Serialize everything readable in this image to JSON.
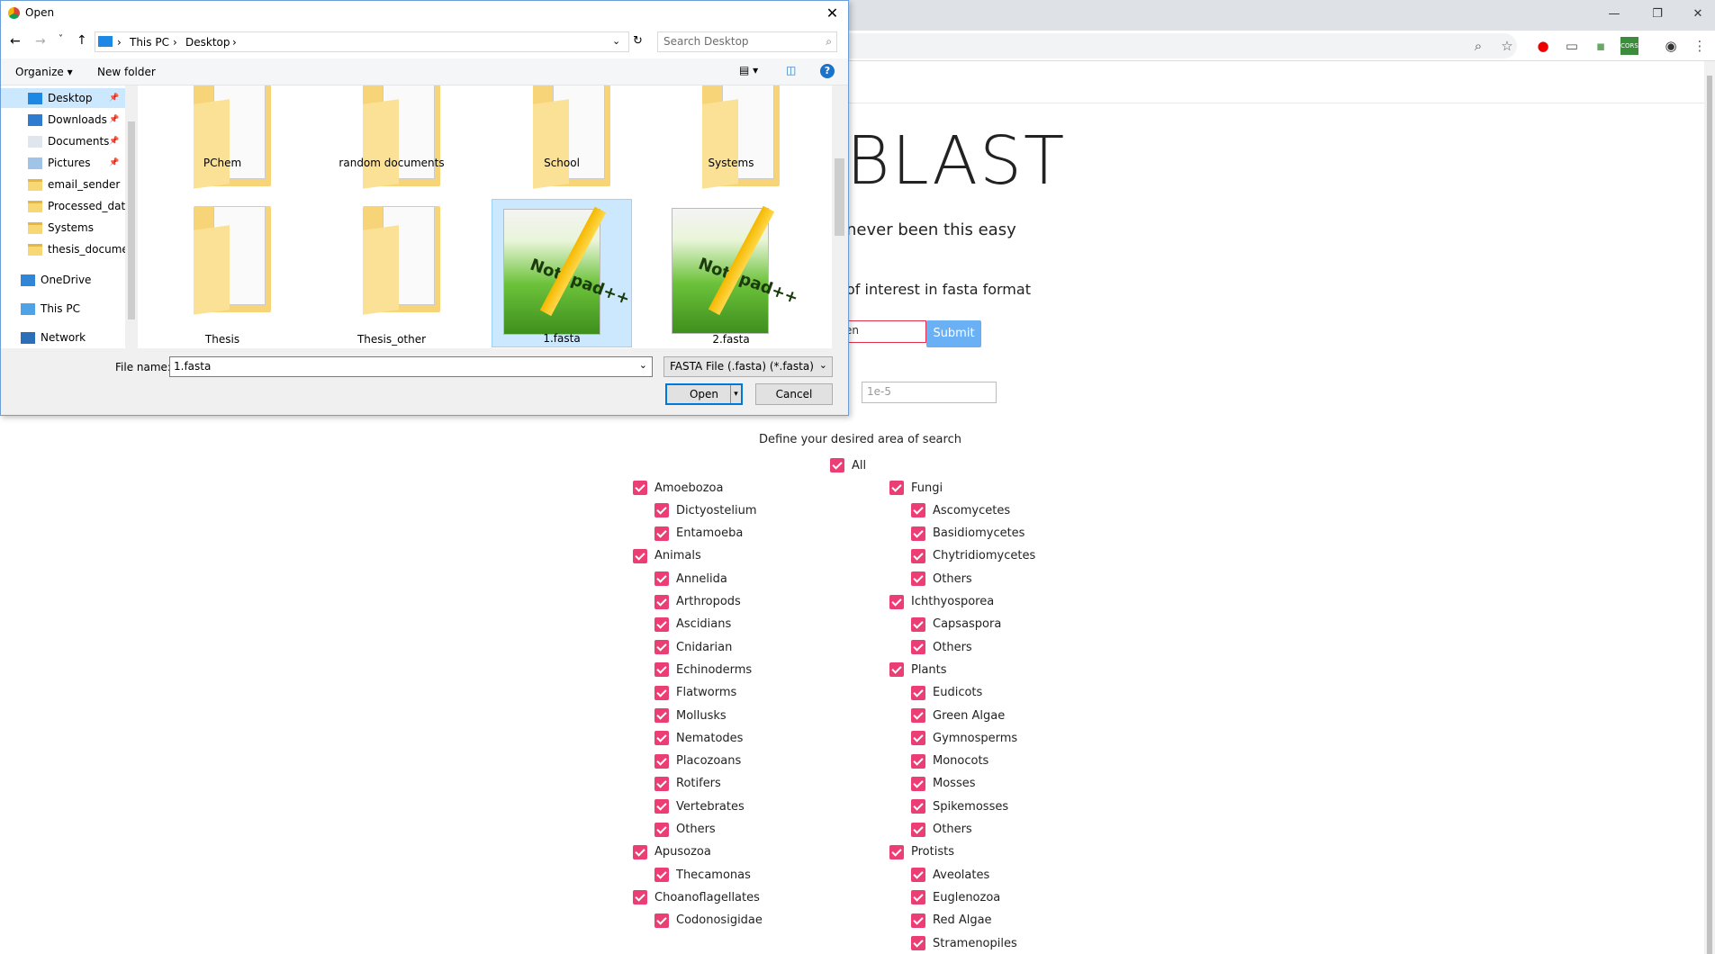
{
  "browser": {
    "window_controls": [
      "—",
      "❐",
      "✕"
    ],
    "extension_label": "CORS"
  },
  "page": {
    "title": "BLAST",
    "tagline": "never been this easy",
    "fasta_label": "of interest in fasta format",
    "sequence_input_value": "en",
    "submit_label": "Submit",
    "evalue_suffix": ")",
    "evalue_placeholder": "1e-5",
    "area_title": "Define your desired area of search",
    "all_label": "All",
    "left_column": [
      {
        "label": "Amoebozoa",
        "level": 0
      },
      {
        "label": "Dictyostelium",
        "level": 1
      },
      {
        "label": "Entamoeba",
        "level": 1
      },
      {
        "label": "Animals",
        "level": 0
      },
      {
        "label": "Annelida",
        "level": 1
      },
      {
        "label": "Arthropods",
        "level": 1
      },
      {
        "label": "Ascidians",
        "level": 1
      },
      {
        "label": "Cnidarian",
        "level": 1
      },
      {
        "label": "Echinoderms",
        "level": 1
      },
      {
        "label": "Flatworms",
        "level": 1
      },
      {
        "label": "Mollusks",
        "level": 1
      },
      {
        "label": "Nematodes",
        "level": 1
      },
      {
        "label": "Placozoans",
        "level": 1
      },
      {
        "label": "Rotifers",
        "level": 1
      },
      {
        "label": "Vertebrates",
        "level": 1
      },
      {
        "label": "Others",
        "level": 1
      },
      {
        "label": "Apusozoa",
        "level": 0
      },
      {
        "label": "Thecamonas",
        "level": 1
      },
      {
        "label": "Choanoflagellates",
        "level": 0
      },
      {
        "label": "Codonosigidae",
        "level": 1
      }
    ],
    "right_column": [
      {
        "label": "Fungi",
        "level": 0
      },
      {
        "label": "Ascomycetes",
        "level": 1
      },
      {
        "label": "Basidiomycetes",
        "level": 1
      },
      {
        "label": "Chytridiomycetes",
        "level": 1
      },
      {
        "label": "Others",
        "level": 1
      },
      {
        "label": "Ichthyosporea",
        "level": 0
      },
      {
        "label": "Capsaspora",
        "level": 1
      },
      {
        "label": "Others",
        "level": 1
      },
      {
        "label": "Plants",
        "level": 0
      },
      {
        "label": "Eudicots",
        "level": 1
      },
      {
        "label": "Green Algae",
        "level": 1
      },
      {
        "label": "Gymnosperms",
        "level": 1
      },
      {
        "label": "Monocots",
        "level": 1
      },
      {
        "label": "Mosses",
        "level": 1
      },
      {
        "label": "Spikemosses",
        "level": 1
      },
      {
        "label": "Others",
        "level": 1
      },
      {
        "label": "Protists",
        "level": 0
      },
      {
        "label": "Aveolates",
        "level": 1
      },
      {
        "label": "Euglenozoa",
        "level": 1
      },
      {
        "label": "Red Algae",
        "level": 1
      },
      {
        "label": "Stramenopiles",
        "level": 1
      }
    ]
  },
  "dialog": {
    "title": "Open",
    "close": "✕",
    "breadcrumb": [
      "This PC",
      "Desktop"
    ],
    "search_placeholder": "Search Desktop",
    "organize_label": "Organize ▾",
    "new_folder_label": "New folder",
    "nav_items": [
      {
        "label": "Desktop",
        "pinned": true,
        "selected": true
      },
      {
        "label": "Downloads",
        "pinned": true
      },
      {
        "label": "Documents",
        "pinned": true
      },
      {
        "label": "Pictures",
        "pinned": true
      },
      {
        "label": "email_sender"
      },
      {
        "label": "Processed_datab"
      },
      {
        "label": "Systems"
      },
      {
        "label": "thesis_documen"
      },
      {
        "label": "OneDrive"
      },
      {
        "label": "This PC"
      },
      {
        "label": "Network"
      }
    ],
    "files": [
      {
        "name": "PChem",
        "kind": "folder"
      },
      {
        "name": "random documents",
        "kind": "folder"
      },
      {
        "name": "School",
        "kind": "folder"
      },
      {
        "name": "Systems",
        "kind": "folder"
      },
      {
        "name": "Thesis",
        "kind": "folder"
      },
      {
        "name": "Thesis_other",
        "kind": "folder"
      },
      {
        "name": "1.fasta",
        "kind": "notepad",
        "selected": true
      },
      {
        "name": "2.fasta",
        "kind": "notepad"
      }
    ],
    "npp_label": "Notepad++",
    "filename_label": "File name:",
    "filename_value": "1.fasta",
    "filetype_value": "FASTA File (.fasta) (*.fasta)",
    "open_label": "Open",
    "cancel_label": "Cancel"
  }
}
